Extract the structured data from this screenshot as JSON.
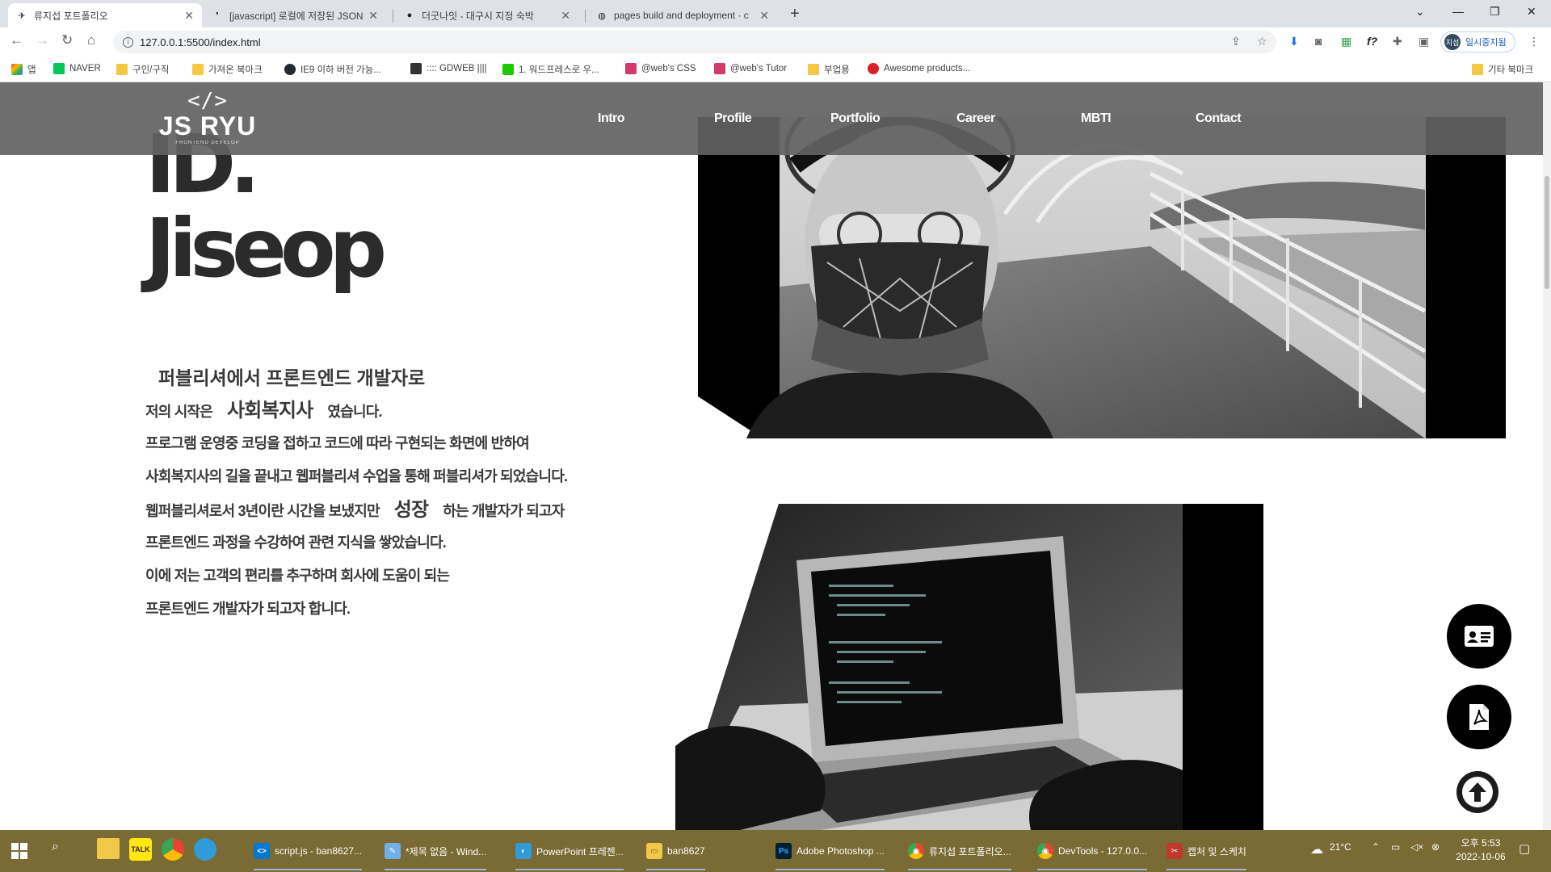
{
  "browser": {
    "tabs": [
      {
        "title": "류지섭 포트폴리오",
        "active": true
      },
      {
        "title": "[javascript] 로컬에 저장된 JSON"
      },
      {
        "title": "더굿나잇 - 대구시 지정 숙박"
      },
      {
        "title": "pages build and deployment · c"
      }
    ],
    "url": "127.0.0.1:5500/index.html",
    "profile_label": "일시중지됨",
    "profile_initial": "지섭",
    "bookmarks": [
      {
        "label": "앱",
        "color": "#e94235"
      },
      {
        "label": "NAVER",
        "color": "#03c75a"
      },
      {
        "label": "구인/구직",
        "color": "#f6c744"
      },
      {
        "label": "가져온 북마크",
        "color": "#f6c744"
      },
      {
        "label": "IE9 이하 버전 가능...",
        "color": "#24292f"
      },
      {
        "label": ":::: GDWEB ||||",
        "color": "#333333"
      },
      {
        "label": "1. 워드프레스로 우...",
        "color": "#1ec800"
      },
      {
        "label": "@web's CSS",
        "color": "#d43a6a"
      },
      {
        "label": "@web's Tutor",
        "color": "#d43a6a"
      },
      {
        "label": "부업용",
        "color": "#f6c744"
      },
      {
        "label": "Awesome products...",
        "color": "#da2128"
      }
    ],
    "other_bookmarks": "기타 북마크"
  },
  "site": {
    "logo": {
      "code": "</>",
      "name": "JS RYU",
      "tagline": "FRONTEND DEVELOP"
    },
    "nav": [
      "Intro",
      "Profile",
      "Portfolio",
      "Career",
      "MBTI",
      "Contact"
    ],
    "title_line1": "ID.",
    "title_line2": "Jiseop",
    "lead": "퍼블리셔에서 프론트엔드 개발자로",
    "line1_a": "저의 시작은",
    "line1_em": "사회복지사",
    "line1_b": "였습니다.",
    "line2": "프로그램 운영중 코딩을 접하고 코드에 따라 구현되는 화면에 반하여",
    "line3": "사회복지사의 길을 끝내고 웹퍼블리셔 수업을 통해 퍼블리셔가 되었습니다.",
    "line4_a": "웹퍼블리셔로서 3년이란 시간을 보냈지만",
    "line4_em": "성장",
    "line4_b": "하는 개발자가 되고자",
    "line5": "프론트엔드 과정을 수강하여 관련 지식을 쌓았습니다.",
    "line6": "이에 저는 고객의 편리를 추구하며 회사에 도움이 되는",
    "line7": "프론트엔드 개발자가 되고자 합니다.",
    "fab_icons": [
      "id-card-icon",
      "pdf-icon",
      "arrow-up-icon"
    ]
  },
  "taskbar": {
    "items": [
      {
        "label": "script.js - ban8627...",
        "color": "#0078d4",
        "glyph": "<>"
      },
      {
        "label": "*제목 없음 - Wind...",
        "color": "#6fb0e8",
        "glyph": "✎"
      },
      {
        "label": "PowerPoint 프레젠...",
        "color": "#2f9bd8",
        "glyph": "◐"
      },
      {
        "label": "ban8627",
        "color": "#f2c84b",
        "glyph": "▭"
      },
      {
        "label": "Adobe Photoshop ...",
        "color": "#001e36",
        "glyph": "Ps"
      },
      {
        "label": "류지섭 포트폴리오...",
        "color": "#e8eaed",
        "glyph": "◉"
      },
      {
        "label": "DevTools - 127.0.0...",
        "color": "#e8eaed",
        "glyph": "◉"
      },
      {
        "label": "캡처 및 스케치",
        "color": "#c0392b",
        "glyph": "✂"
      }
    ],
    "temperature": "21°C",
    "time": "오후 5:53",
    "date": "2022-10-06"
  }
}
